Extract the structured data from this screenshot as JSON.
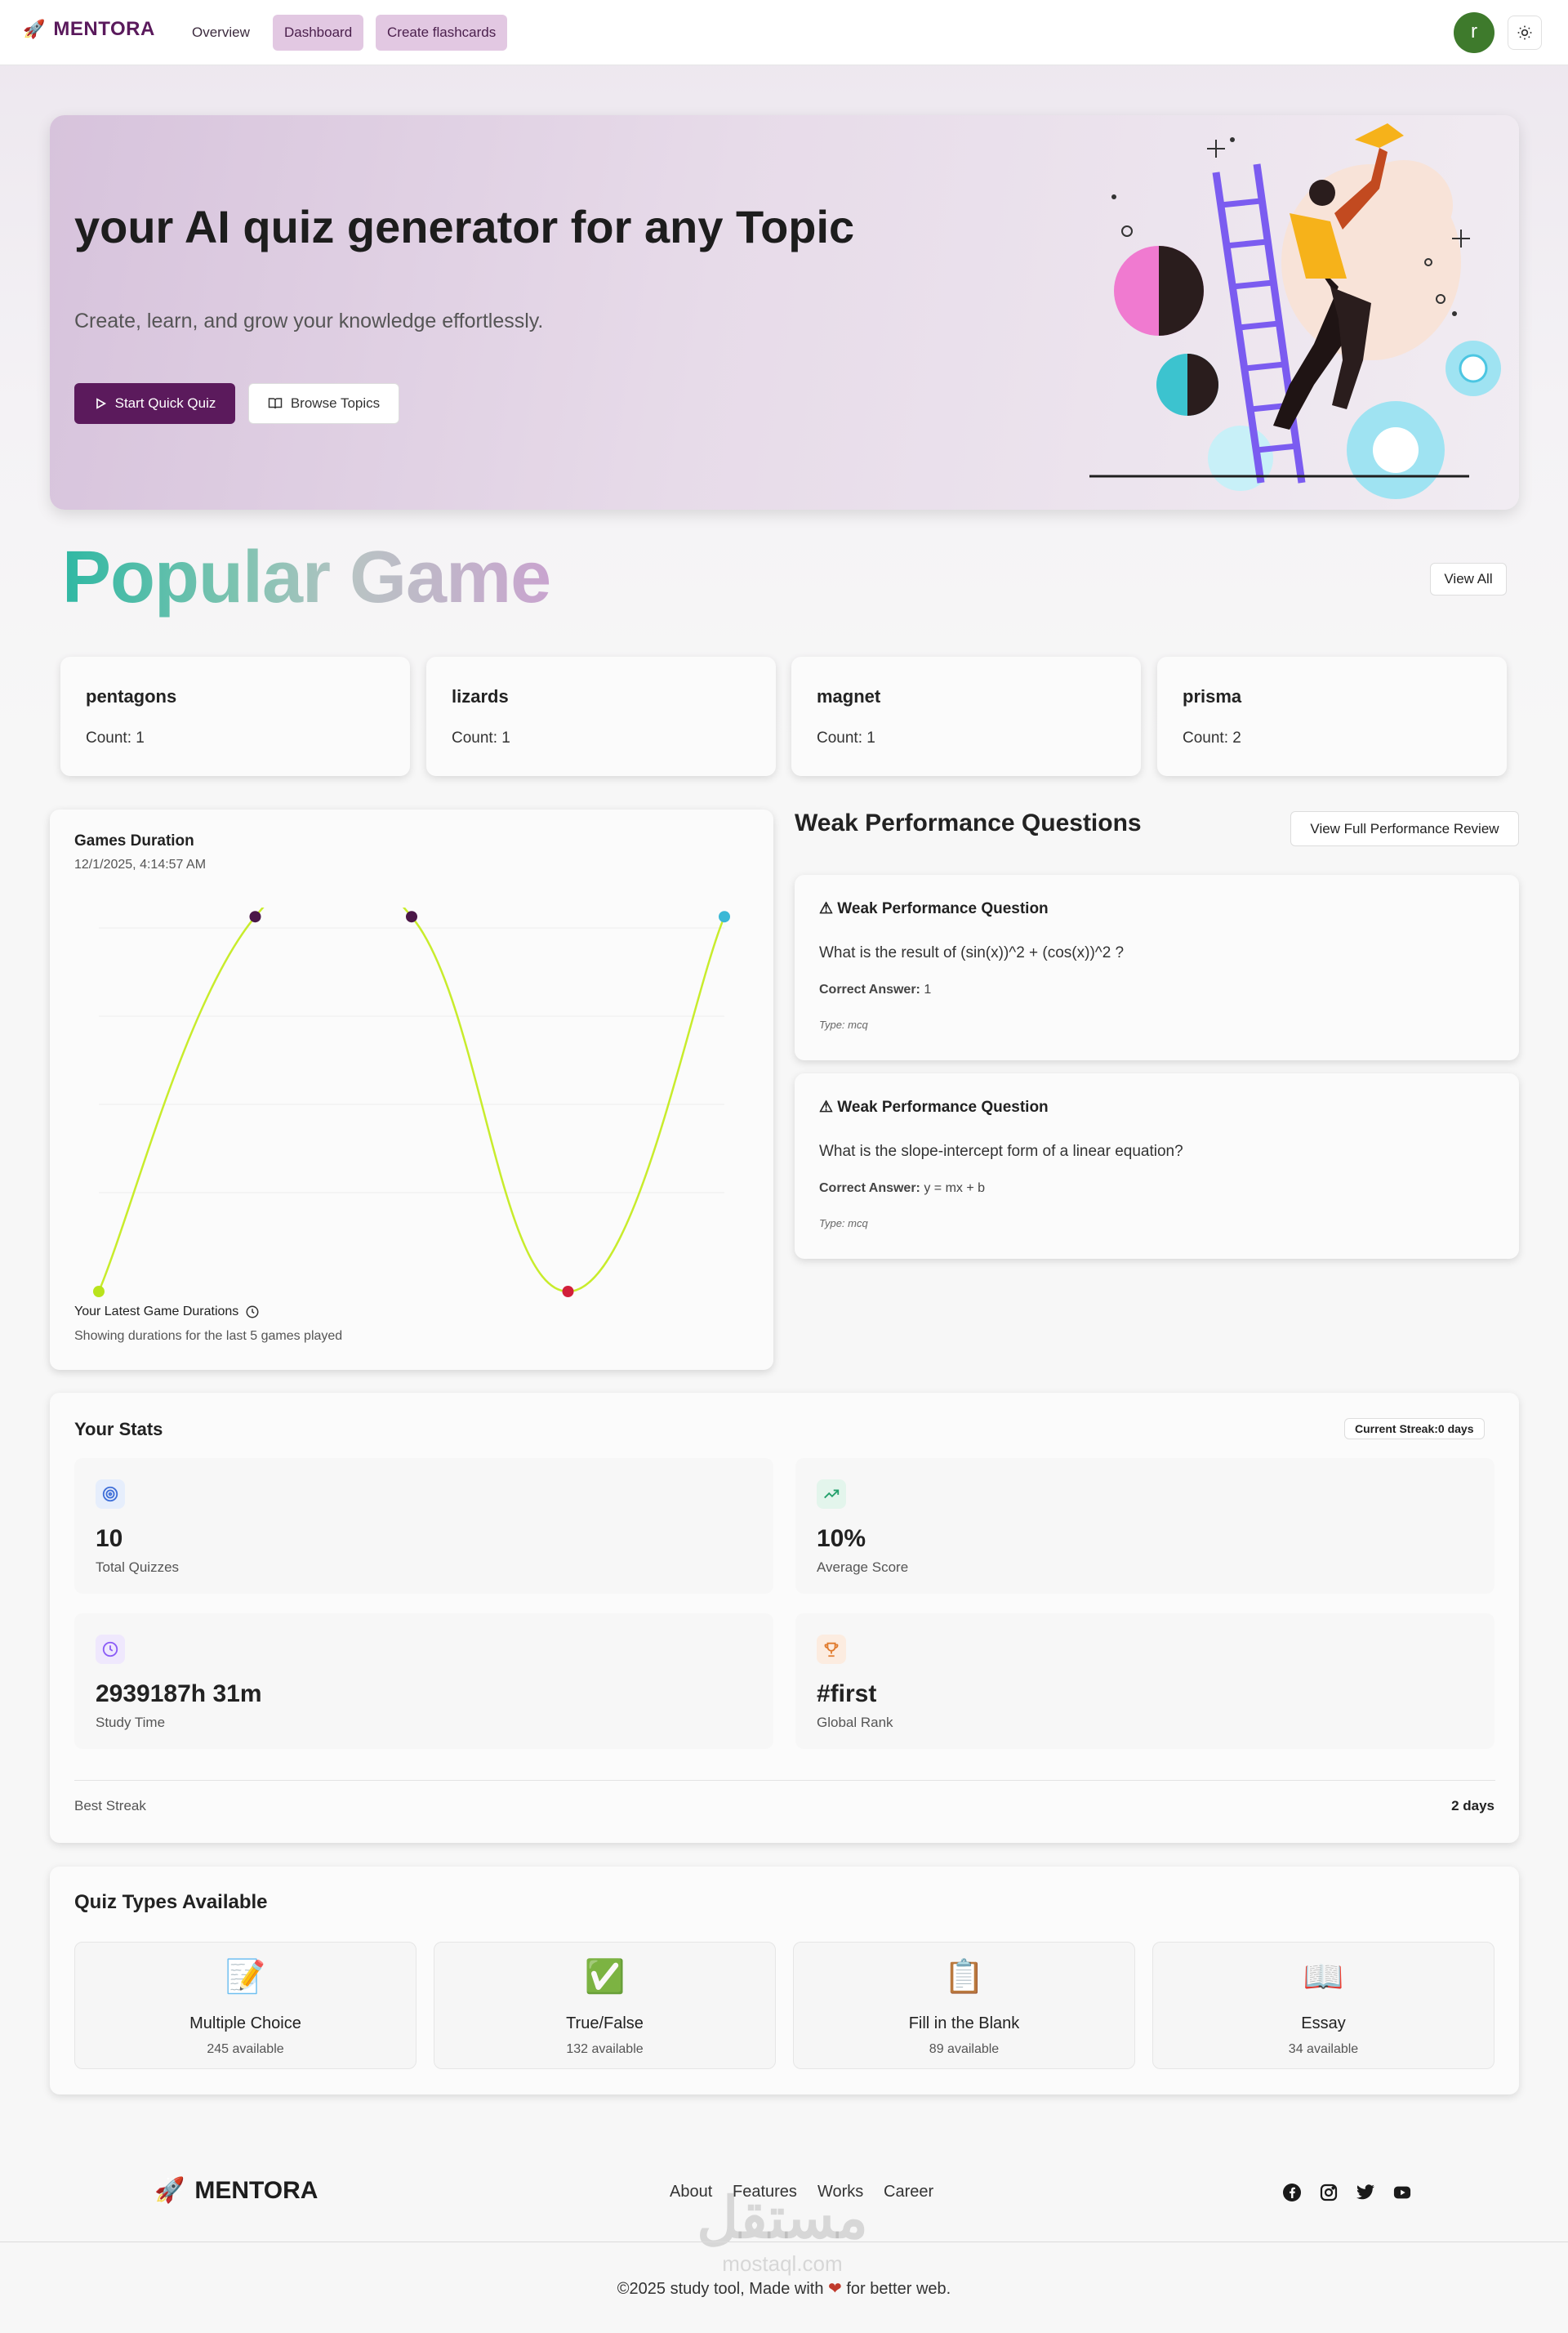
{
  "nav": {
    "brand": "MENTORA",
    "links": [
      "Overview",
      "Dashboard",
      "Create flashcards"
    ],
    "avatar_letter": "r"
  },
  "hero": {
    "title": "your AI quiz generator for any Topic",
    "subtitle": "Create, learn, and grow your knowledge effortlessly.",
    "primary_button": "Start Quick Quiz",
    "secondary_button": "Browse Topics"
  },
  "popular": {
    "title": "Popular Game",
    "view_all": "View All",
    "games": [
      {
        "name": "pentagons",
        "count": "Count: 1"
      },
      {
        "name": "lizards",
        "count": "Count: 1"
      },
      {
        "name": "magnet",
        "count": "Count: 1"
      },
      {
        "name": "prisma",
        "count": "Count: 2"
      }
    ]
  },
  "duration_chart": {
    "title": "Games Duration",
    "date": "12/1/2025, 4:14:57 AM",
    "footer_title": "Your Latest Game Durations",
    "footer_sub": "Showing durations for the last 5 games played"
  },
  "chart_data": {
    "type": "line",
    "title": "Games Duration",
    "xlabel": "",
    "ylabel": "",
    "x": [
      1,
      2,
      3,
      4,
      5
    ],
    "series": [
      {
        "values": [
          0,
          4.1,
          4.1,
          0,
          4.1
        ]
      }
    ],
    "point_colors": [
      "#b9e31c",
      "#4a1747",
      "#4a1747",
      "#d11f3a",
      "#3ab8d6"
    ],
    "line_color": "#c8ec2c",
    "ylim": [
      0,
      4.2
    ],
    "grid": true,
    "note": ""
  },
  "weak": {
    "title": "Weak Performance Questions",
    "button": "View Full Performance Review",
    "items": [
      {
        "heading": "⚠ Weak Performance Question",
        "question": "What is the result of (sin(x))^2 + (cos(x))^2 ?",
        "answer_label": "Correct Answer:",
        "answer": "1",
        "type": "Type: mcq"
      },
      {
        "heading": "⚠ Weak Performance Question",
        "question": "What is the slope-intercept form of a linear equation?",
        "answer_label": "Correct Answer:",
        "answer": "y = mx + b",
        "type": "Type: mcq"
      }
    ]
  },
  "stats": {
    "title": "Your Stats",
    "streak_badge": "Current Streak:0 days",
    "items": [
      {
        "value": "10",
        "label": "Total Quizzes",
        "icon": "target-icon",
        "color": "#3f6fd8"
      },
      {
        "value": "10%",
        "label": "Average Score",
        "icon": "trending-up-icon",
        "color": "#22a06b"
      },
      {
        "value": "2939187h 31m",
        "label": "Study Time",
        "icon": "clock-icon",
        "color": "#8b5cf6"
      },
      {
        "value": "#first",
        "label": "Global Rank",
        "icon": "trophy-icon",
        "color": "#e07a2c"
      }
    ],
    "best_streak_label": "Best Streak",
    "best_streak_value": "2 days"
  },
  "quiz_types": {
    "title": "Quiz Types Available",
    "items": [
      {
        "emoji": "📝",
        "name": "Multiple Choice",
        "available": "245 available"
      },
      {
        "emoji": "✅",
        "name": "True/False",
        "available": "132 available"
      },
      {
        "emoji": "📋",
        "name": "Fill in the Blank",
        "available": "89 available"
      },
      {
        "emoji": "📖",
        "name": "Essay",
        "available": "34 available"
      }
    ]
  },
  "footer": {
    "brand": "MENTORA",
    "links": [
      "About",
      "Features",
      "Works",
      "Career"
    ],
    "social": [
      "facebook-icon",
      "instagram-icon",
      "twitter-icon",
      "youtube-icon"
    ],
    "copyright_pre": "©2025 study tool, Made with",
    "copyright_post": "for better web.",
    "watermark": "مستقل",
    "watermark_sub": "mostaql.com"
  }
}
